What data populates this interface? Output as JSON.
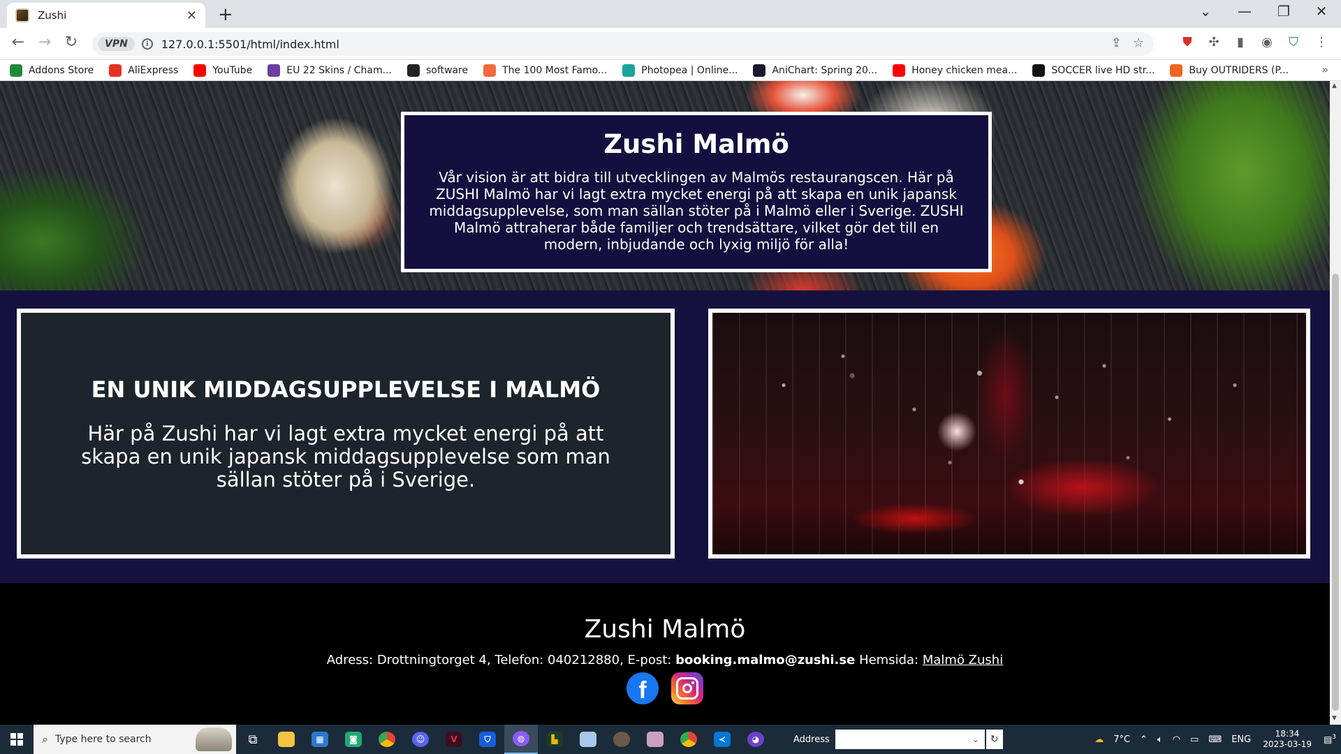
{
  "browser": {
    "tab_title": "Zushi",
    "url": "127.0.0.1:5501/html/index.html",
    "vpn_label": "VPN",
    "bookmarks": [
      {
        "label": "Addons Store",
        "color": "#1f8a3b"
      },
      {
        "label": "AliExpress",
        "color": "#e43225"
      },
      {
        "label": "YouTube",
        "color": "#ff0000"
      },
      {
        "label": "EU 22 Skins / Cham...",
        "color": "#6b3fa0"
      },
      {
        "label": "software",
        "color": "#222222"
      },
      {
        "label": "The 100 Most Famo...",
        "color": "#f26b3a"
      },
      {
        "label": "Photopea | Online...",
        "color": "#18a497"
      },
      {
        "label": "AniChart: Spring 20...",
        "color": "#1a1a2e"
      },
      {
        "label": "Honey chicken mea...",
        "color": "#ff0000"
      },
      {
        "label": "SOCCER live HD str...",
        "color": "#111111"
      },
      {
        "label": "Buy OUTRIDERS (P...",
        "color": "#f26522"
      }
    ]
  },
  "hero": {
    "title": "Zushi Malmö",
    "text": "Vår vision är att bidra till utvecklingen av Malmös restaurangscen. Här på ZUSHI Malmö har vi lagt extra mycket energi på att skapa en unik japansk middagsupplevelse, som man sällan stöter på i Malmö eller i Sverige. ZUSHI Malmö attraherar både familjer och trendsättare, vilket gör det till en modern, inbjudande och lyxig miljö för alla!"
  },
  "feature": {
    "title": "EN UNIK MIDDAGSUPPLEVELSE I MALMÖ",
    "text": "Här på Zushi har vi lagt extra mycket energi på att skapa en unik japansk middagsupplevelse som man sällan stöter på i Sverige."
  },
  "footer": {
    "title": "Zushi Malmö",
    "address_prefix": "Adress: Drottningtorget 4, Telefon: 040212880, E-post:",
    "email": "booking.malmo@zushi.se",
    "website_prefix": "Hemsida:",
    "website_link": "Malmö Zushi",
    "facebook_glyph": "f"
  },
  "taskbar": {
    "search_placeholder": "Type here to search",
    "address_label": "Address",
    "weather": "7°C",
    "language": "ENG",
    "time": "18:34",
    "date": "2023-03-19",
    "notifications": "3"
  }
}
